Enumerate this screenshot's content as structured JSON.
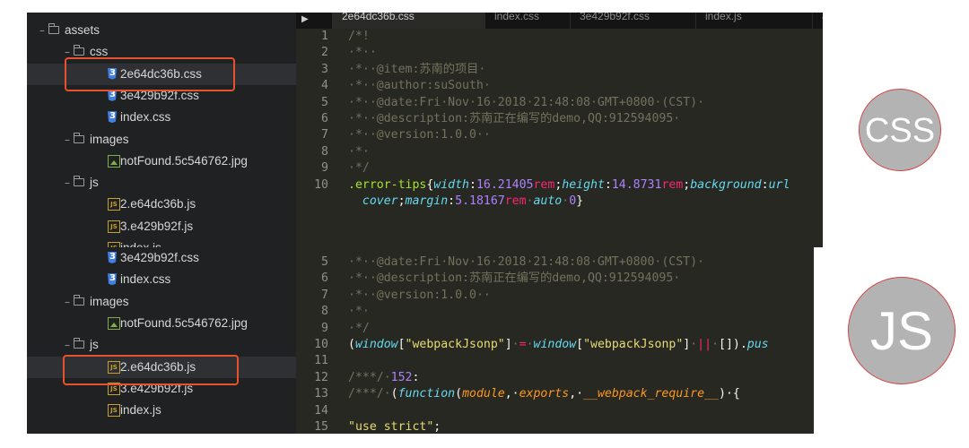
{
  "panel1": {
    "tree": [
      {
        "depth": 0,
        "kind": "folder",
        "label": "assets"
      },
      {
        "depth": 1,
        "kind": "folder",
        "label": "css"
      },
      {
        "depth": 2,
        "kind": "css",
        "label": "2e64dc36b.css",
        "selected": true
      },
      {
        "depth": 2,
        "kind": "css",
        "label": "3e429b92f.css"
      },
      {
        "depth": 2,
        "kind": "css",
        "label": "index.css"
      },
      {
        "depth": 1,
        "kind": "folder",
        "label": "images"
      },
      {
        "depth": 2,
        "kind": "image",
        "label": "notFound.5c546762.jpg"
      },
      {
        "depth": 1,
        "kind": "folder",
        "label": "js"
      },
      {
        "depth": 2,
        "kind": "js",
        "label": "2.e64dc36b.js"
      },
      {
        "depth": 2,
        "kind": "js",
        "label": "3.e429b92f.js"
      },
      {
        "depth": 2,
        "kind": "js",
        "label": "index.js"
      }
    ],
    "tabs": [
      {
        "label": "2e64dc36b.css",
        "active": true
      },
      {
        "label": "index.css"
      },
      {
        "label": "3e429b92f.css"
      },
      {
        "label": "index.js"
      },
      {
        "label": "ass"
      }
    ],
    "code": [
      {
        "n": "1",
        "parts": [
          {
            "t": "/*!",
            "c": "comment"
          }
        ]
      },
      {
        "n": "2",
        "parts": [
          {
            "t": "·*··",
            "c": "comment"
          }
        ]
      },
      {
        "n": "3",
        "parts": [
          {
            "t": "·*··@item:苏南的项目·",
            "c": "comment"
          }
        ]
      },
      {
        "n": "4",
        "parts": [
          {
            "t": "·*··@author:suSouth·",
            "c": "comment"
          }
        ]
      },
      {
        "n": "5",
        "parts": [
          {
            "t": "·*··@date:Fri·Nov·16·2018·21:48:08·GMT+0800·(CST)·",
            "c": "comment"
          }
        ]
      },
      {
        "n": "6",
        "parts": [
          {
            "t": "·*··@description:苏南正在编写的demo,QQ:912594095·",
            "c": "comment"
          }
        ]
      },
      {
        "n": "7",
        "parts": [
          {
            "t": "·*··@version:1.0.0··",
            "c": "comment"
          }
        ]
      },
      {
        "n": "8",
        "parts": [
          {
            "t": "·*·",
            "c": "comment"
          }
        ]
      },
      {
        "n": "9",
        "parts": [
          {
            "t": "·*/",
            "c": "comment"
          }
        ]
      },
      {
        "n": "10",
        "parts": [
          {
            "t": ".error-tips",
            "c": "sel"
          },
          {
            "t": "{",
            "c": "plain"
          },
          {
            "t": "width",
            "c": "prop"
          },
          {
            "t": ":",
            "c": "plain"
          },
          {
            "t": "16.21405",
            "c": "num"
          },
          {
            "t": "rem",
            "c": "unit"
          },
          {
            "t": ";",
            "c": "plain"
          },
          {
            "t": "height",
            "c": "prop"
          },
          {
            "t": ":",
            "c": "plain"
          },
          {
            "t": "14.8731",
            "c": "num"
          },
          {
            "t": "rem",
            "c": "unit"
          },
          {
            "t": ";",
            "c": "plain"
          },
          {
            "t": "background",
            "c": "prop"
          },
          {
            "t": ":",
            "c": "plain"
          },
          {
            "t": "url",
            "c": "fn"
          }
        ]
      },
      {
        "n": "",
        "parts": [
          {
            "t": "  cover",
            "c": "fn"
          },
          {
            "t": ";",
            "c": "plain"
          },
          {
            "t": "margin",
            "c": "prop"
          },
          {
            "t": ":",
            "c": "plain"
          },
          {
            "t": "5.18167",
            "c": "num"
          },
          {
            "t": "rem",
            "c": "unit"
          },
          {
            "t": "·",
            "c": "comment"
          },
          {
            "t": "auto",
            "c": "fn"
          },
          {
            "t": "·",
            "c": "comment"
          },
          {
            "t": "0",
            "c": "num"
          },
          {
            "t": "}",
            "c": "plain"
          }
        ]
      }
    ]
  },
  "panel2": {
    "tree": [
      {
        "depth": 2,
        "kind": "css",
        "label": "3e429b92f.css"
      },
      {
        "depth": 2,
        "kind": "css",
        "label": "index.css"
      },
      {
        "depth": 1,
        "kind": "folder",
        "label": "images"
      },
      {
        "depth": 2,
        "kind": "image",
        "label": "notFound.5c546762.jpg"
      },
      {
        "depth": 1,
        "kind": "folder",
        "label": "js"
      },
      {
        "depth": 2,
        "kind": "js",
        "label": "2.e64dc36b.js",
        "selected": true
      },
      {
        "depth": 2,
        "kind": "js",
        "label": "3.e429b92f.js"
      },
      {
        "depth": 2,
        "kind": "js",
        "label": "index.js"
      }
    ],
    "code": [
      {
        "n": "5",
        "parts": [
          {
            "t": "·*··@date:Fri·Nov·16·2018·21:48:08·GMT+0800·(CST)·",
            "c": "comment"
          }
        ]
      },
      {
        "n": "6",
        "parts": [
          {
            "t": "·*··@description:苏南正在编写的demo,QQ:912594095·",
            "c": "comment"
          }
        ]
      },
      {
        "n": "7",
        "parts": [
          {
            "t": "·*··@version:1.0.0··",
            "c": "comment"
          }
        ]
      },
      {
        "n": "8",
        "parts": [
          {
            "t": "·*·",
            "c": "comment"
          }
        ]
      },
      {
        "n": "9",
        "parts": [
          {
            "t": "·*/",
            "c": "comment"
          }
        ]
      },
      {
        "n": "10",
        "parts": [
          {
            "t": "(",
            "c": "plain"
          },
          {
            "t": "window",
            "c": "fn"
          },
          {
            "t": "[",
            "c": "plain"
          },
          {
            "t": "\"webpackJsonp\"",
            "c": "str"
          },
          {
            "t": "]",
            "c": "plain"
          },
          {
            "t": "·",
            "c": "comment"
          },
          {
            "t": "=",
            "c": "op"
          },
          {
            "t": "·",
            "c": "comment"
          },
          {
            "t": "window",
            "c": "fn"
          },
          {
            "t": "[",
            "c": "plain"
          },
          {
            "t": "\"webpackJsonp\"",
            "c": "str"
          },
          {
            "t": "]",
            "c": "plain"
          },
          {
            "t": "·",
            "c": "comment"
          },
          {
            "t": "||",
            "c": "op"
          },
          {
            "t": "·",
            "c": "comment"
          },
          {
            "t": "[]).",
            "c": "plain"
          },
          {
            "t": "pus",
            "c": "fn"
          }
        ]
      },
      {
        "n": "11",
        "parts": []
      },
      {
        "n": "12",
        "parts": [
          {
            "t": "/***/·",
            "c": "comment"
          },
          {
            "t": "152",
            "c": "num"
          },
          {
            "t": ":",
            "c": "plain"
          }
        ]
      },
      {
        "n": "13",
        "parts": [
          {
            "t": "/***/·",
            "c": "comment"
          },
          {
            "t": "(",
            "c": "plain"
          },
          {
            "t": "function",
            "c": "fn"
          },
          {
            "t": "(",
            "c": "plain"
          },
          {
            "t": "module",
            "c": "arg"
          },
          {
            "t": ",·",
            "c": "plain"
          },
          {
            "t": "exports",
            "c": "arg"
          },
          {
            "t": ",·",
            "c": "plain"
          },
          {
            "t": "__webpack_require__",
            "c": "arg"
          },
          {
            "t": ")·{",
            "c": "plain"
          }
        ]
      },
      {
        "n": "14",
        "parts": []
      },
      {
        "n": "15",
        "parts": [
          {
            "t": "\"use strict\"",
            "c": "str"
          },
          {
            "t": ";",
            "c": "plain"
          }
        ]
      }
    ]
  },
  "badges": {
    "css": "CSS",
    "js": "JS"
  },
  "colors": {
    "highlight": "#e8512d",
    "badge_bg": "#b3b3b3",
    "badge_border": "#d64343"
  }
}
